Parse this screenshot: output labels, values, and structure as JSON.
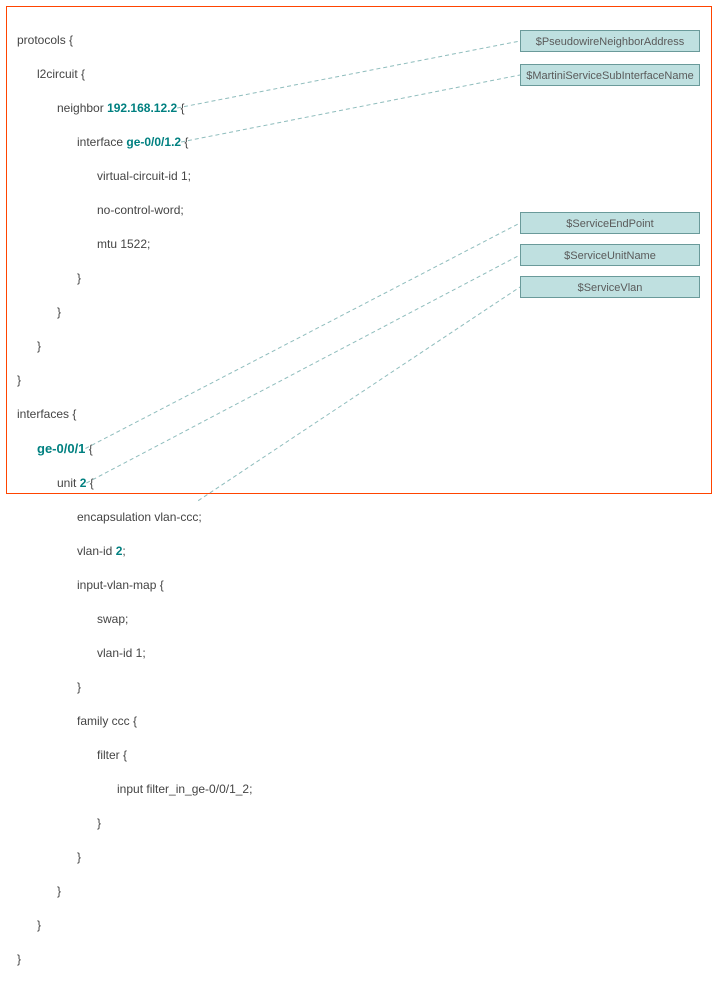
{
  "code": {
    "protocols_open": "protocols {",
    "l2circuit_open": "l2circuit {",
    "neighbor_kw": "neighbor",
    "neighbor_val": "192.168.12.2",
    "neighbor_open": " {",
    "iface_kw": "interface",
    "iface_val": "ge-0/0/1.2",
    "iface_open": " {",
    "vc_id": "virtual-circuit-id 1;",
    "no_cw": "no-control-word;",
    "mtu": "mtu 1522;",
    "close": "}",
    "interfaces_open": "interfaces {",
    "ifname_val": "ge-0/0/1",
    "ifname_open": " {",
    "unit_kw": "unit",
    "unit_val": "2",
    "unit_open": " {",
    "encap": "encapsulation vlan-ccc;",
    "vlan_kw": "vlan-id",
    "vlan_val": "2",
    "semi": ";",
    "ivm_open": "input-vlan-map {",
    "swap": "swap;",
    "vlan_id1": "vlan-id 1;",
    "fam_open": "family ccc {",
    "filter_open": "filter {",
    "filter_in": "input filter_in_ge-0/0/1_2;"
  },
  "tags": {
    "t1": "$PseudowireNeighborAddress",
    "t2": "$MartiniServiceSubInterfaceName",
    "t3": "$ServiceEndPoint",
    "t4": "$ServiceUnitName",
    "t5": "$ServiceVlan"
  }
}
